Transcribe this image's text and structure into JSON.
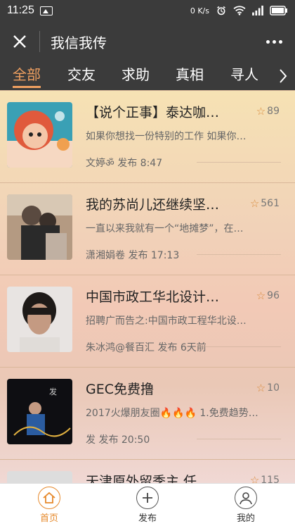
{
  "status": {
    "time": "11:25",
    "speed": "0 K/s",
    "battery": ""
  },
  "titlebar": {
    "title": "我信我传"
  },
  "tabs": [
    "全部",
    "交友",
    "求助",
    "真相",
    "寻人"
  ],
  "posts": [
    {
      "title": "【说个正事】泰达咖…",
      "stars": "89",
      "desc": "如果你想找一份特别的工作 如果你…",
      "meta": "文婷ॐ 发布 8:47",
      "thumb_colors": [
        "#f4c7a8",
        "#e05a3c",
        "#3aa0b5"
      ]
    },
    {
      "title": "我的苏尚儿还继续坚…",
      "stars": "561",
      "desc": "一直以来我就有一个“地摊梦”，在…",
      "meta": "潇湘娟卷 发布 17:13",
      "thumb_colors": [
        "#5a4a40",
        "#b49a82",
        "#2a2a2a"
      ]
    },
    {
      "title": "中国市政工华北设计…",
      "stars": "96",
      "desc": "招聘广而告之:中国市政工程华北设…",
      "meta": "朱冰鸿@餐百汇 发布 6天前",
      "thumb_colors": [
        "#e8e4e2",
        "#1e1a18",
        "#c49a82"
      ]
    },
    {
      "title": "GEC免费撸",
      "stars": "10",
      "desc": "2017火爆朋友圈🔥🔥🔥 1.免费趋势…",
      "meta": "发 发布 20:50",
      "thumb_colors": [
        "#0e0e12",
        "#2b5ca0",
        "#e0b040"
      ]
    },
    {
      "title": "天津原外留季主 任…",
      "stars": "115",
      "desc": "",
      "meta": "",
      "thumb_colors": [
        "#222",
        "#888",
        "#ddd"
      ]
    }
  ],
  "bottomnav": [
    {
      "label": "首页"
    },
    {
      "label": "发布"
    },
    {
      "label": "我的"
    }
  ]
}
